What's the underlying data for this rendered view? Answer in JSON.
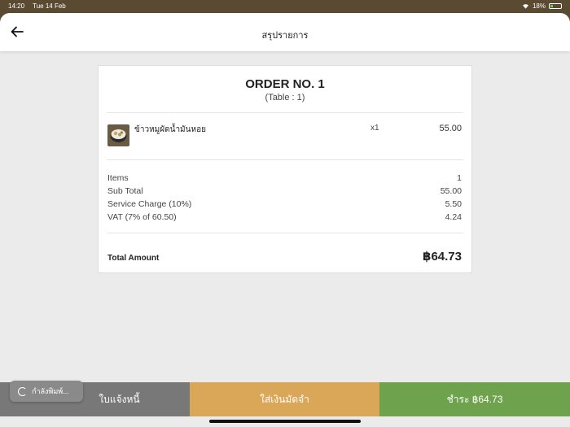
{
  "status_bar": {
    "time": "14:20",
    "date": "Tue 14 Feb",
    "battery_text": "18%"
  },
  "header": {
    "title": "สรุปรายการ",
    "back_icon": "arrow-left-icon"
  },
  "order": {
    "title": "ORDER NO. 1",
    "table": "(Table : 1)"
  },
  "items": [
    {
      "name": "ข้าวหมูผัดน้ำมันหอย",
      "qty": "x1",
      "price": "55.00"
    }
  ],
  "summary": [
    {
      "label": "Items",
      "value": "1"
    },
    {
      "label": "Sub Total",
      "value": "55.00"
    },
    {
      "label": "Service Charge (10%)",
      "value": "5.50"
    },
    {
      "label": "VAT (7% of 60.50)",
      "value": "4.24"
    }
  ],
  "total": {
    "label": "Total Amount",
    "value": "฿64.73"
  },
  "actions": {
    "invoice": "ใบแจ้งหนี้",
    "deposit": "ใส่เงินมัดจำ",
    "pay": "ชำระ ฿64.73"
  },
  "toast": {
    "text": "กำลังพิมพ์..."
  },
  "colors": {
    "pay": "#6ea24c",
    "deposit": "#d9a757",
    "invoice": "#787878"
  }
}
